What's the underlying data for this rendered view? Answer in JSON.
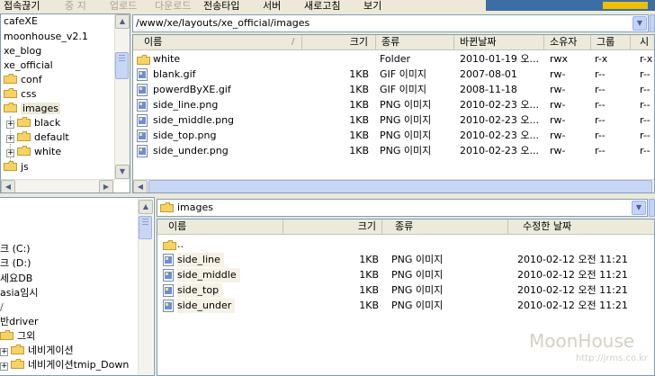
{
  "menu": {
    "items": [
      {
        "label": "접속끊기",
        "disabled": false
      },
      {
        "label": "중 지",
        "disabled": true
      },
      {
        "label": "업로드",
        "disabled": true
      },
      {
        "label": "다운로드",
        "disabled": true
      },
      {
        "label": "전송타입",
        "disabled": false
      },
      {
        "label": "서버",
        "disabled": false
      },
      {
        "label": "새로고침",
        "disabled": false
      },
      {
        "label": "보기",
        "disabled": false
      }
    ]
  },
  "remote_tree": {
    "items": [
      {
        "label": "cafeXE"
      },
      {
        "label": "moonhouse_v2.1"
      },
      {
        "label": "xe_blog"
      },
      {
        "label": "xe_official"
      },
      {
        "label": "conf"
      },
      {
        "label": "css"
      },
      {
        "label": "images"
      },
      {
        "label": "black"
      },
      {
        "label": "default"
      },
      {
        "label": "white"
      },
      {
        "label": "js"
      }
    ]
  },
  "remote_path": "/www/xe/layouts/xe_official/images",
  "remote_list": {
    "columns": [
      "이름",
      "크기",
      "종류",
      "바뀐날짜",
      "소유자",
      "그룹",
      "시"
    ],
    "rows": [
      {
        "name": "white",
        "size": "",
        "type": "Folder",
        "date": "2010-01-19 오...",
        "owner": "rwx",
        "group": "r-x",
        "perm": "r-x"
      },
      {
        "name": "blank.gif",
        "size": "1KB",
        "type": "GIF 이미지",
        "date": "2007-08-01",
        "owner": "rw-",
        "group": "r--",
        "perm": "r--"
      },
      {
        "name": "powerdByXE.gif",
        "size": "1KB",
        "type": "GIF 이미지",
        "date": "2008-11-18",
        "owner": "rw-",
        "group": "r--",
        "perm": "r--"
      },
      {
        "name": "side_line.png",
        "size": "1KB",
        "type": "PNG 이미지",
        "date": "2010-02-23 오...",
        "owner": "rw-",
        "group": "r--",
        "perm": "r--"
      },
      {
        "name": "side_middle.png",
        "size": "1KB",
        "type": "PNG 이미지",
        "date": "2010-02-23 오...",
        "owner": "rw-",
        "group": "r--",
        "perm": "r--"
      },
      {
        "name": "side_top.png",
        "size": "1KB",
        "type": "PNG 이미지",
        "date": "2010-02-23 오...",
        "owner": "rw-",
        "group": "r--",
        "perm": "r--"
      },
      {
        "name": "side_under.png",
        "size": "1KB",
        "type": "PNG 이미지",
        "date": "2010-02-23 오...",
        "owner": "rw-",
        "group": "r--",
        "perm": "r--"
      }
    ]
  },
  "local_tree": {
    "items": [
      {
        "label": "크 (C:)"
      },
      {
        "label": "크 (D:)"
      },
      {
        "label": "세요DB"
      },
      {
        "label": "asia임시"
      },
      {
        "label": "반driver"
      },
      {
        "label": "그외"
      },
      {
        "label": "네비게이션"
      },
      {
        "label": "네비게이션tmip_Down"
      }
    ]
  },
  "local_path": "images",
  "local_list": {
    "columns": [
      "이름",
      "크기",
      "종류",
      "수정한 날짜"
    ],
    "parent": "..",
    "rows": [
      {
        "name": "side_line",
        "size": "1KB",
        "type": "PNG 이미지",
        "date": "2010-02-12 오전 11:21"
      },
      {
        "name": "side_middle",
        "size": "1KB",
        "type": "PNG 이미지",
        "date": "2010-02-12 오전 11:21"
      },
      {
        "name": "side_top",
        "size": "1KB",
        "type": "PNG 이미지",
        "date": "2010-02-12 오전 11:21"
      },
      {
        "name": "side_under",
        "size": "1KB",
        "type": "PNG 이미지",
        "date": "2010-02-12 오전 11:21"
      }
    ]
  },
  "watermark": {
    "title": "MoonHouse",
    "url": "http://jrms.co.kr"
  },
  "colors": {
    "folder": "#f6d267",
    "folder_edge": "#c89b2a",
    "accent": "#3a6ea5"
  }
}
